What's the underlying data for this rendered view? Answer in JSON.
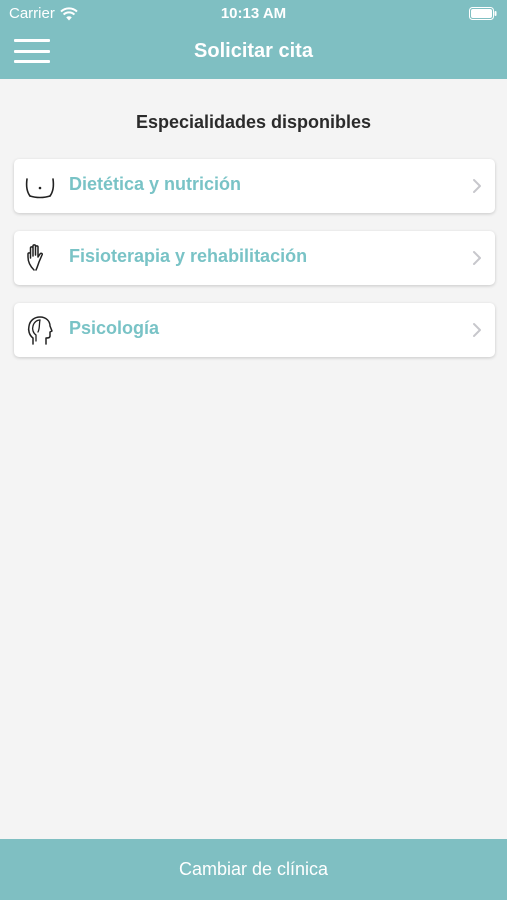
{
  "status_bar": {
    "carrier": "Carrier",
    "time": "10:13 AM",
    "icons": [
      "wifi-icon",
      "battery-icon"
    ]
  },
  "nav": {
    "title": "Solicitar cita",
    "menu_icon": "hamburger-menu-icon"
  },
  "content": {
    "section_title": "Especialidades disponibles",
    "specialties": [
      {
        "label": "Dietética y nutrición",
        "icon": "belly-icon"
      },
      {
        "label": "Fisioterapia y rehabilitación",
        "icon": "hand-icon"
      },
      {
        "label": "Psicología",
        "icon": "head-profile-icon"
      }
    ]
  },
  "footer": {
    "button_label": "Cambiar de clínica"
  },
  "colors": {
    "accent": "#7fbfc2",
    "label_teal": "#79c3c6",
    "background": "#f4f4f4"
  }
}
